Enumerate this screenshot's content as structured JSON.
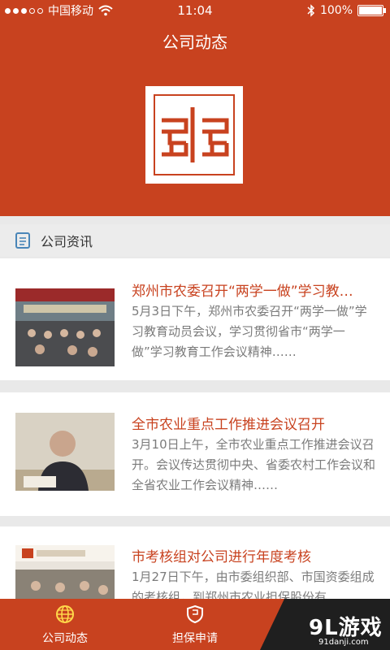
{
  "status_bar": {
    "carrier": "中国移动",
    "time": "11:04",
    "battery": "100%"
  },
  "header": {
    "title": "公司动态"
  },
  "section": {
    "title": "公司资讯"
  },
  "news": [
    {
      "title": "郑州市农委召开“两学一做”学习教…",
      "body": "5月3日下午，郑州市农委召开“两学一做”学习教育动员会议，学习贯彻省市“两学一做”学习教育工作会议精神……"
    },
    {
      "title": "全市农业重点工作推进会议召开",
      "body": "3月10日上午，全市农业重点工作推进会议召开。会议传达贯彻中央、省委农村工作会议和全省农业工作会议精神……"
    },
    {
      "title": "市考核组对公司进行年度考核",
      "body": "1月27日下午，由市委组织部、市国资委组成的考核组，到郑州市农业担保股份有"
    }
  ],
  "tabs": [
    {
      "label": "公司动态"
    },
    {
      "label": "担保申请"
    }
  ],
  "watermark": {
    "brand": "9L游戏",
    "url": "91danji.com"
  },
  "colors": {
    "primary": "#c8421f",
    "title_red": "#c8421f",
    "text_gray": "#7b7b7b"
  }
}
